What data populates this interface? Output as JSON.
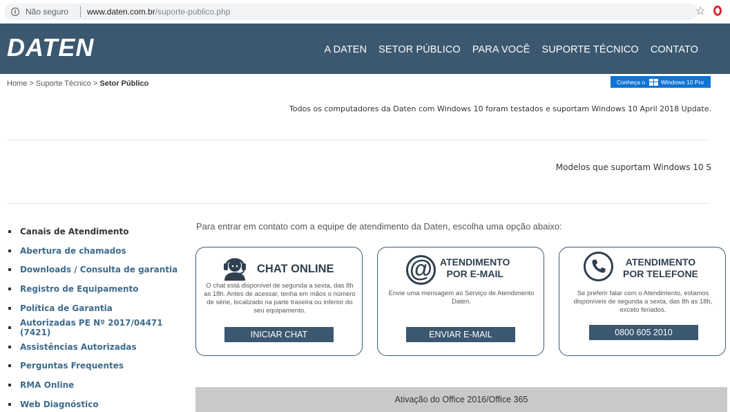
{
  "browser": {
    "security_label": "Não seguro",
    "url_host": "www.daten.com.br",
    "url_path": "/suporte-publico.php"
  },
  "header": {
    "logo": "DATEN",
    "nav": [
      "A DATEN",
      "SETOR PÚBLICO",
      "PARA VOCÊ",
      "SUPORTE TÉCNICO",
      "CONTATO"
    ]
  },
  "breadcrumb": {
    "home": "Home",
    "support": "Suporte Técnico",
    "current": "Setor Público",
    "sep": ">"
  },
  "windows_badge": {
    "prefix": "Conheça o",
    "product": "Windows 10 Pro"
  },
  "notice": "Todos os computadores da Daten com Windows 10 foram testados e suportam Windows 10 April 2018 Update.",
  "models_link": "Modelos que suportam Windows 10 S",
  "sidebar": {
    "items": [
      "Canais de Atendimento",
      "Abertura de chamados",
      "Downloads / Consulta de garantia",
      "Registro de Equipamento",
      "Política de Garantia",
      "Autorizadas PE Nº 2017/04471 (7421)",
      "Assistências Autorizadas",
      "Perguntas Frequentes",
      "RMA Online",
      "Web Diagnóstico"
    ]
  },
  "main": {
    "intro": "Para entrar em contato com a equipe de atendimento da Daten, escolha uma opção abaixo:",
    "chat": {
      "title": "CHAT ONLINE",
      "desc": "O chat está disponível de segunda a sexta, das 8h as 18h. Antes de acessar, tenha em mãos o número de série, localizado na parte traseira ou inferior do seu equipamento.",
      "button": "INICIAR CHAT"
    },
    "email": {
      "title_line1": "ATENDIMENTO",
      "title_line2": "POR E-MAIL",
      "desc": "Envie uma mensagem ao Serviço de Atendimento Daten.",
      "button": "ENVIAR E-MAIL"
    },
    "phone": {
      "title_line1": "ATENDIMENTO",
      "title_line2": "POR TELEFONE",
      "desc": "Se preferir falar com o Atendimento, estamos disponíveis de segunda a sexta, das 8h as 18h, exceto feriados.",
      "button": "0800 605 2010"
    },
    "office_bar": "Ativação do Office 2016/Office 365"
  }
}
